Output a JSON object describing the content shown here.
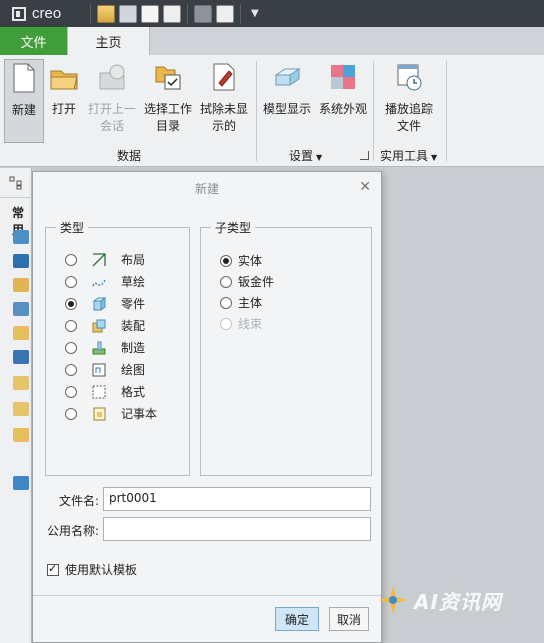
{
  "app": {
    "logo_text": "creo"
  },
  "quick_access": {
    "icons": [
      "open-folder-icon",
      "save-icon",
      "new-doc-icon",
      "window-icon",
      "regenerate-icon",
      "close-window-icon"
    ]
  },
  "tabs": [
    {
      "label": "文件",
      "color": "#3f9e3a"
    },
    {
      "label": "主页",
      "active": true
    }
  ],
  "ribbon": {
    "buttons": {
      "new": "新建",
      "open": "打开",
      "open_prev": [
        "打开上一",
        "会话"
      ],
      "select_dir": [
        "选择工作",
        "目录"
      ],
      "erase": [
        "拭除未显",
        "示的"
      ],
      "model_display": "模型显示",
      "system_appearance": "系统外观",
      "play_trail": [
        "播放追踪",
        "文件"
      ]
    },
    "groups": {
      "data": "数据",
      "settings": "设置",
      "utilities": "实用工具"
    }
  },
  "left_panel": {
    "label": "常用"
  },
  "dialog": {
    "title": "新建",
    "type_group": {
      "legend": "类型",
      "options": [
        {
          "label": "布局",
          "icon": "layout-icon",
          "selected": false
        },
        {
          "label": "草绘",
          "icon": "sketch-icon",
          "selected": false
        },
        {
          "label": "零件",
          "icon": "part-icon",
          "selected": true
        },
        {
          "label": "装配",
          "icon": "assembly-icon",
          "selected": false
        },
        {
          "label": "制造",
          "icon": "manufacturing-icon",
          "selected": false
        },
        {
          "label": "绘图",
          "icon": "drawing-icon",
          "selected": false
        },
        {
          "label": "格式",
          "icon": "format-icon",
          "selected": false
        },
        {
          "label": "记事本",
          "icon": "notebook-icon",
          "selected": false
        }
      ]
    },
    "subtype_group": {
      "legend": "子类型",
      "options": [
        {
          "label": "实体",
          "selected": true,
          "disabled": false
        },
        {
          "label": "钣金件",
          "selected": false,
          "disabled": false
        },
        {
          "label": "主体",
          "selected": false,
          "disabled": false
        },
        {
          "label": "线束",
          "selected": false,
          "disabled": true
        }
      ]
    },
    "file_name": {
      "label": "文件名:",
      "value": "prt0001"
    },
    "common_name": {
      "label": "公用名称:",
      "value": ""
    },
    "use_default_template": {
      "label": "使用默认模板",
      "checked": true
    },
    "ok_label": "确定",
    "cancel_label": "取消"
  },
  "watermark": {
    "text": "AI资讯网"
  },
  "colors": {
    "accent_green": "#3f9e3a",
    "titlebar": "#3a3f45",
    "primary_button": "#cfe6f6"
  }
}
